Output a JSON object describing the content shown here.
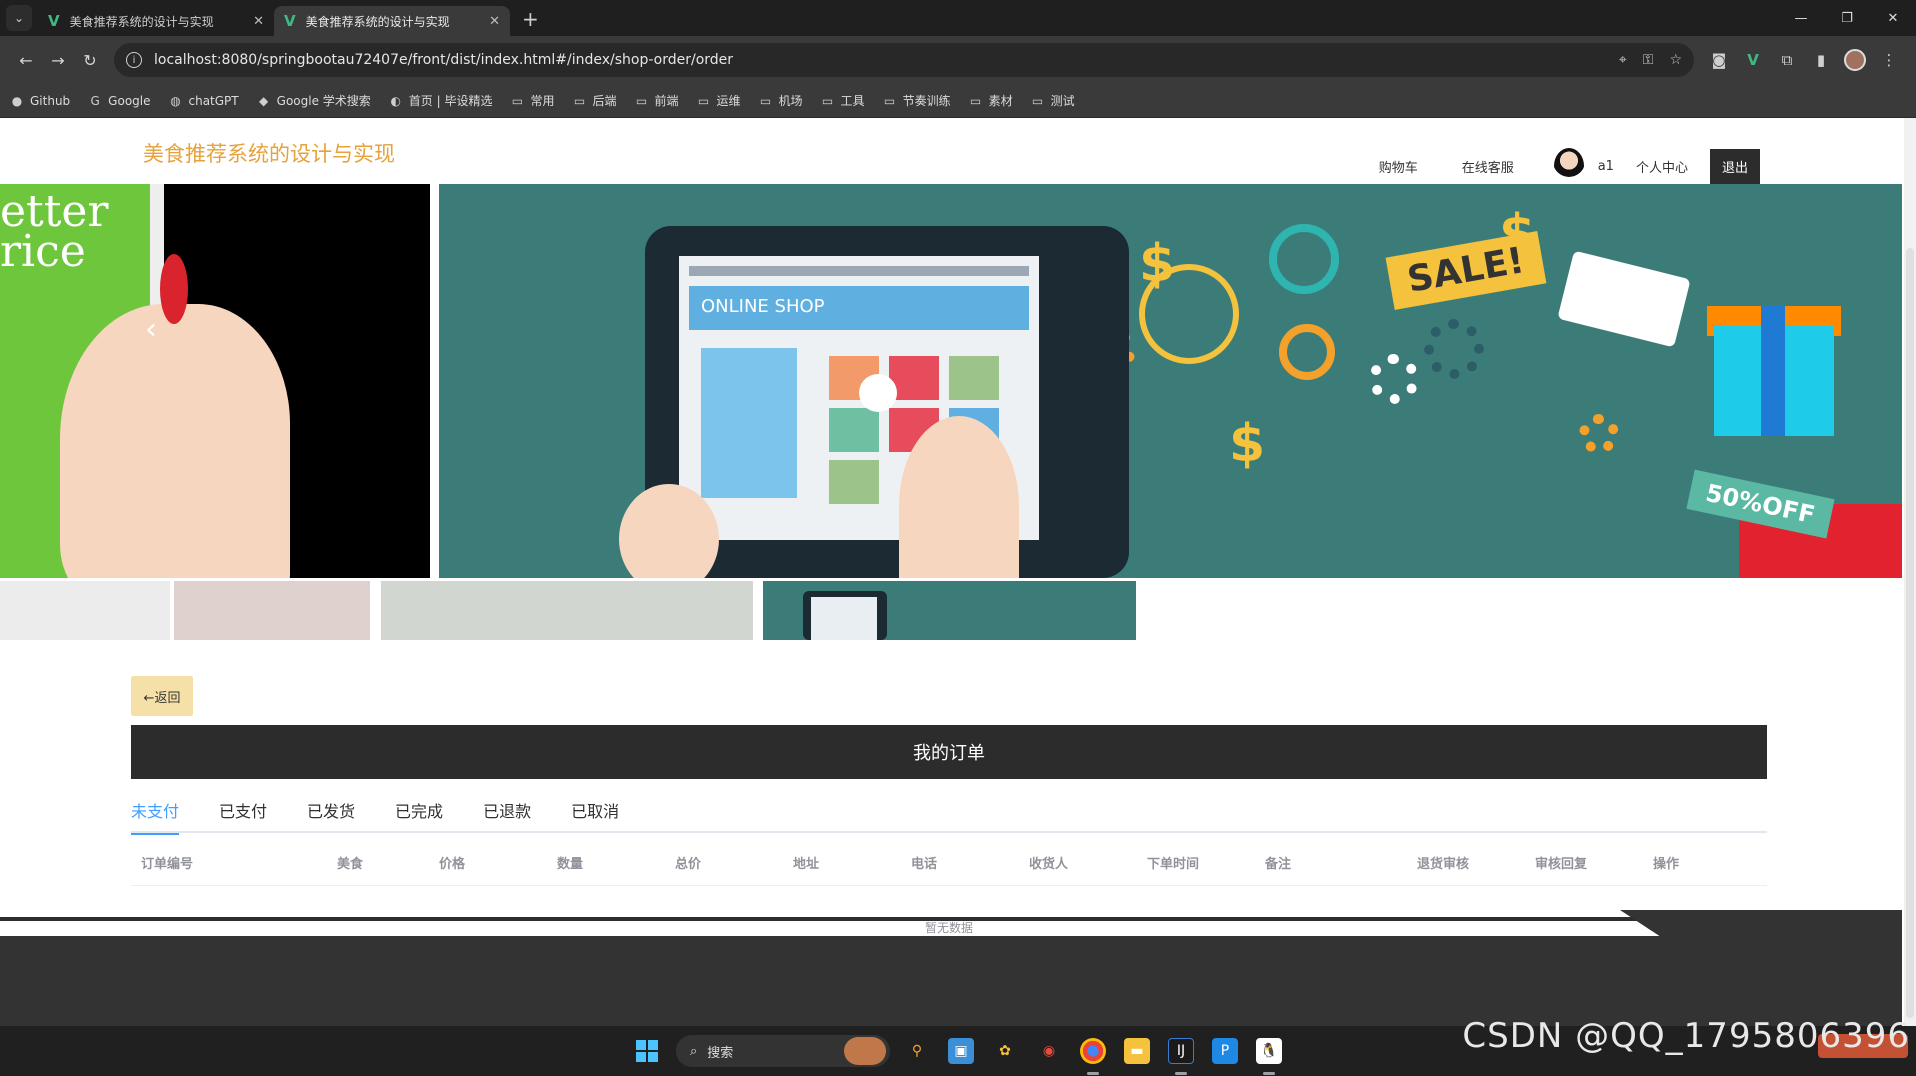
{
  "browser": {
    "tabs": [
      {
        "title": "美食推荐系统的设计与实现",
        "active": false
      },
      {
        "title": "美食推荐系统的设计与实现",
        "active": true
      }
    ],
    "url": "localhost:8080/springbootau72407e/front/dist/index.html#/index/shop-order/order",
    "bookmarks": [
      {
        "label": "Github",
        "icon": "github-icon"
      },
      {
        "label": "Google",
        "icon": "google-icon"
      },
      {
        "label": "chatGPT",
        "icon": "chatgpt-icon"
      },
      {
        "label": "Google 学术搜索",
        "icon": "scholar-icon"
      },
      {
        "label": "首页 | 毕设精选",
        "icon": "site-icon"
      },
      {
        "label": "常用",
        "icon": "folder-icon"
      },
      {
        "label": "后端",
        "icon": "folder-icon"
      },
      {
        "label": "前端",
        "icon": "folder-icon"
      },
      {
        "label": "运维",
        "icon": "folder-icon"
      },
      {
        "label": "机场",
        "icon": "folder-icon"
      },
      {
        "label": "工具",
        "icon": "folder-icon"
      },
      {
        "label": "节奏训练",
        "icon": "folder-icon"
      },
      {
        "label": "素材",
        "icon": "folder-icon"
      },
      {
        "label": "测试",
        "icon": "folder-icon"
      }
    ]
  },
  "site": {
    "title": "美食推荐系统的设计与实现",
    "nav": {
      "cart": "购物车",
      "service": "在线客服",
      "username": "a1",
      "profile": "个人中心",
      "logout": "退出"
    },
    "accent_color": "#e6a23c"
  },
  "carousel": {
    "left_slide_text": "etter\nrice",
    "main_slide": {
      "shop_label": "ONLINE SHOP",
      "sale_label": "SALE!",
      "off_label": "50%OFF"
    }
  },
  "orders": {
    "back_label": "←返回",
    "heading": "我的订单",
    "status_tabs": [
      "未支付",
      "已支付",
      "已发货",
      "已完成",
      "已退款",
      "已取消"
    ],
    "active_tab": "未支付",
    "columns": [
      "订单编号",
      "美食",
      "价格",
      "数量",
      "总价",
      "地址",
      "电话",
      "收货人",
      "下单时间",
      "备注",
      "退货审核",
      "审核回复",
      "操作"
    ],
    "empty_text": "暂无数据"
  },
  "taskbar": {
    "search_placeholder": "搜索",
    "watermark": "CSDN @QQ_1795806396"
  }
}
